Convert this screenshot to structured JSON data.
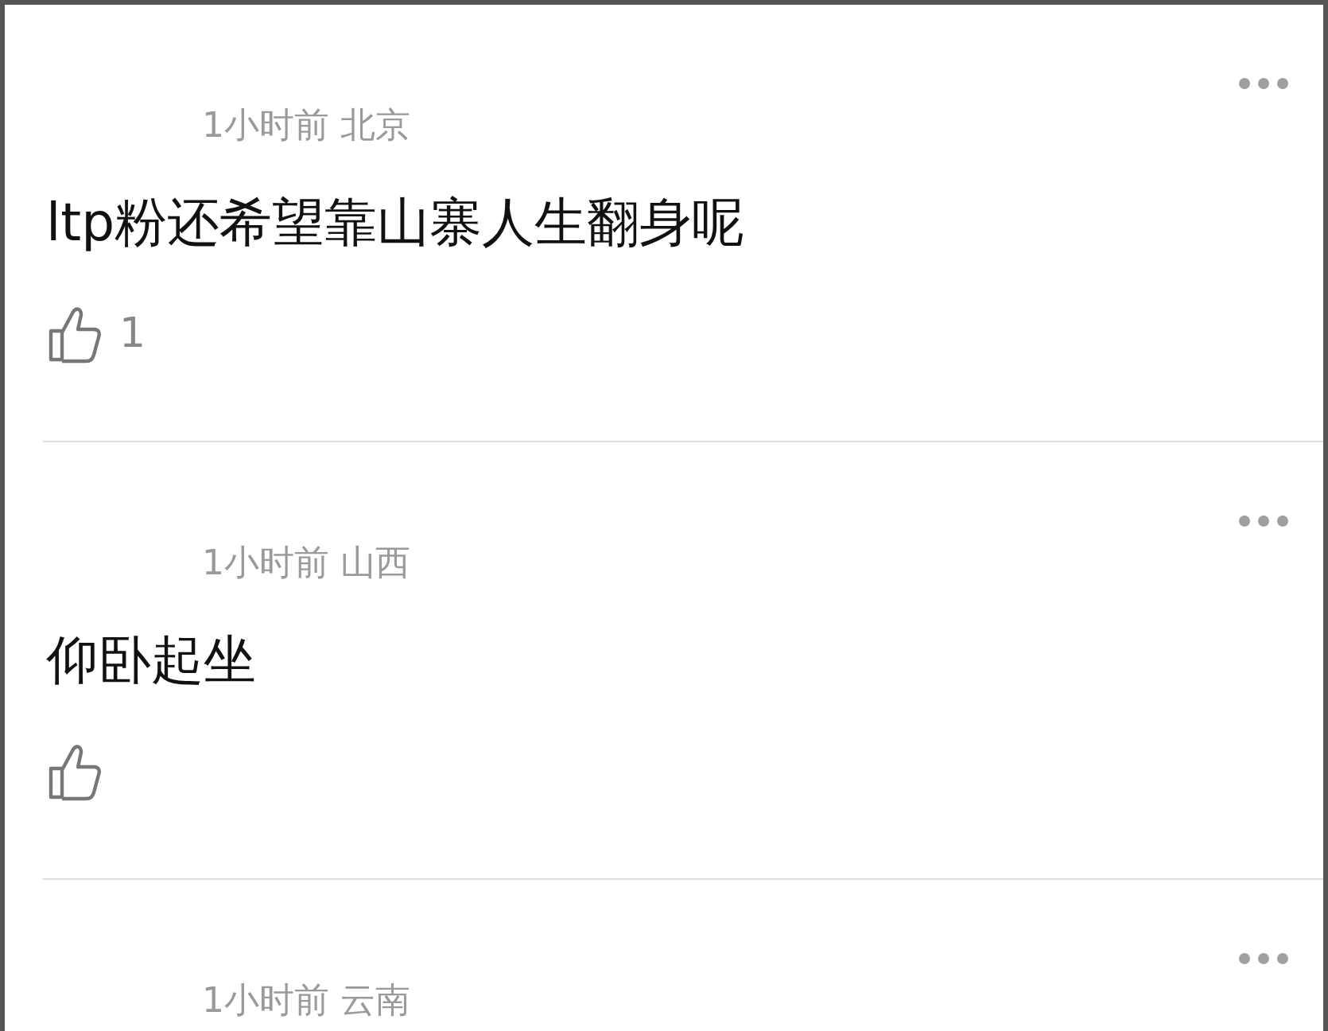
{
  "comments": [
    {
      "meta": "1小时前 北京",
      "text": "ltp粉还希望靠山寨人生翻身呢",
      "likes": "1"
    },
    {
      "meta": "1小时前 山西",
      "text": "仰卧起坐"
    },
    {
      "meta": "1小时前 云南"
    }
  ]
}
